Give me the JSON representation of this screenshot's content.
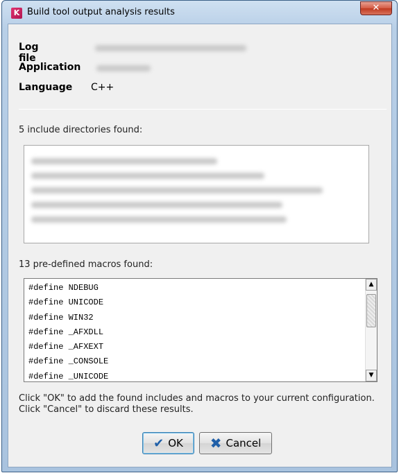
{
  "window": {
    "title": "Build tool output analysis results",
    "icon_letter": "K",
    "close_glyph": "✕"
  },
  "info": {
    "log_file_label": "Log file",
    "application_label": "Application",
    "language_label": "Language",
    "language_value": "C++"
  },
  "includes": {
    "header": "5 include directories found:"
  },
  "macros": {
    "header": "13 pre-defined macros found:",
    "items": [
      "#define NDEBUG",
      "#define UNICODE",
      "#define WIN32",
      "#define _AFXDLL",
      "#define _AFXEXT",
      "#define _CONSOLE",
      "#define _UNICODE"
    ]
  },
  "hint": {
    "line1": "Click \"OK\" to add the found includes and macros to your current configuration.",
    "line2": "Click \"Cancel\" to discard these results."
  },
  "buttons": {
    "ok_label": "OK",
    "cancel_label": "Cancel"
  },
  "colors": {
    "icon_accent": "#1f5fa8",
    "app_icon": "#c41c5c",
    "close_button": "#c03a21"
  }
}
